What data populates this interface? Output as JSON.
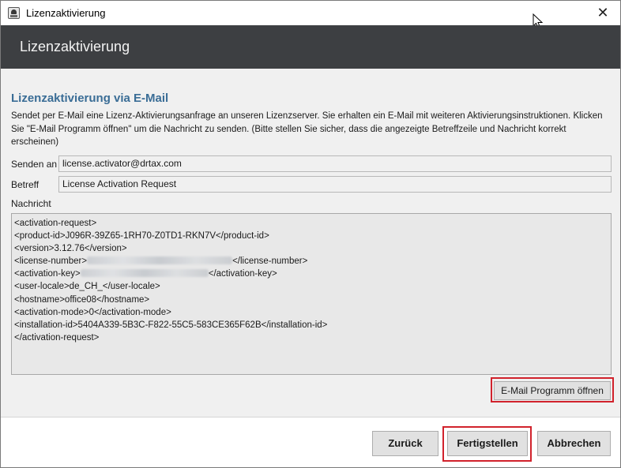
{
  "window": {
    "title": "Lizenzaktivierung",
    "close_glyph": "✕"
  },
  "header": {
    "title": "Lizenzaktivierung"
  },
  "section": {
    "title": "Lizenzaktivierung via E-Mail",
    "description": "Sendet per E-Mail eine Lizenz-Aktivierungsanfrage an unseren Lizenzserver. Sie erhalten ein E-Mail mit weiteren Aktivierungsinstruktionen. Klicken Sie \"E-Mail Programm öffnen\" um die Nachricht zu senden. (Bitte stellen Sie sicher, dass die angezeigte Betreffzeile und Nachricht korrekt erscheinen)"
  },
  "form": {
    "send_to_label": "Senden an",
    "send_to_value": "license.activator@drtax.com",
    "subject_label": "Betreff",
    "subject_value": "License Activation Request",
    "message_label": "Nachricht"
  },
  "message": {
    "lines": [
      "<activation-request>",
      "<product-id>J096R-39Z65-1RH70-Z0TD1-RKN7V</product-id>",
      "<version>3.12.76</version>",
      "<license-number>",
      "</license-number>",
      "<activation-key>",
      "</activation-key>",
      "<user-locale>de_CH_</user-locale>",
      "<hostname>office08</hostname>",
      "<activation-mode>0</activation-mode>",
      "<installation-id>5404A339-5B3C-F822-55C5-583CE365F62B</installation-id>",
      "</activation-request>"
    ]
  },
  "buttons": {
    "open_email": "E-Mail Programm öffnen",
    "back": "Zurück",
    "finish": "Fertigstellen",
    "cancel": "Abbrechen"
  },
  "colors": {
    "header_band": "#3d3f42",
    "section_title": "#3a6d96",
    "highlight": "#d1222c"
  },
  "icons": {
    "app": "app-icon",
    "close": "close-icon",
    "cursor": "mouse-cursor-icon"
  }
}
